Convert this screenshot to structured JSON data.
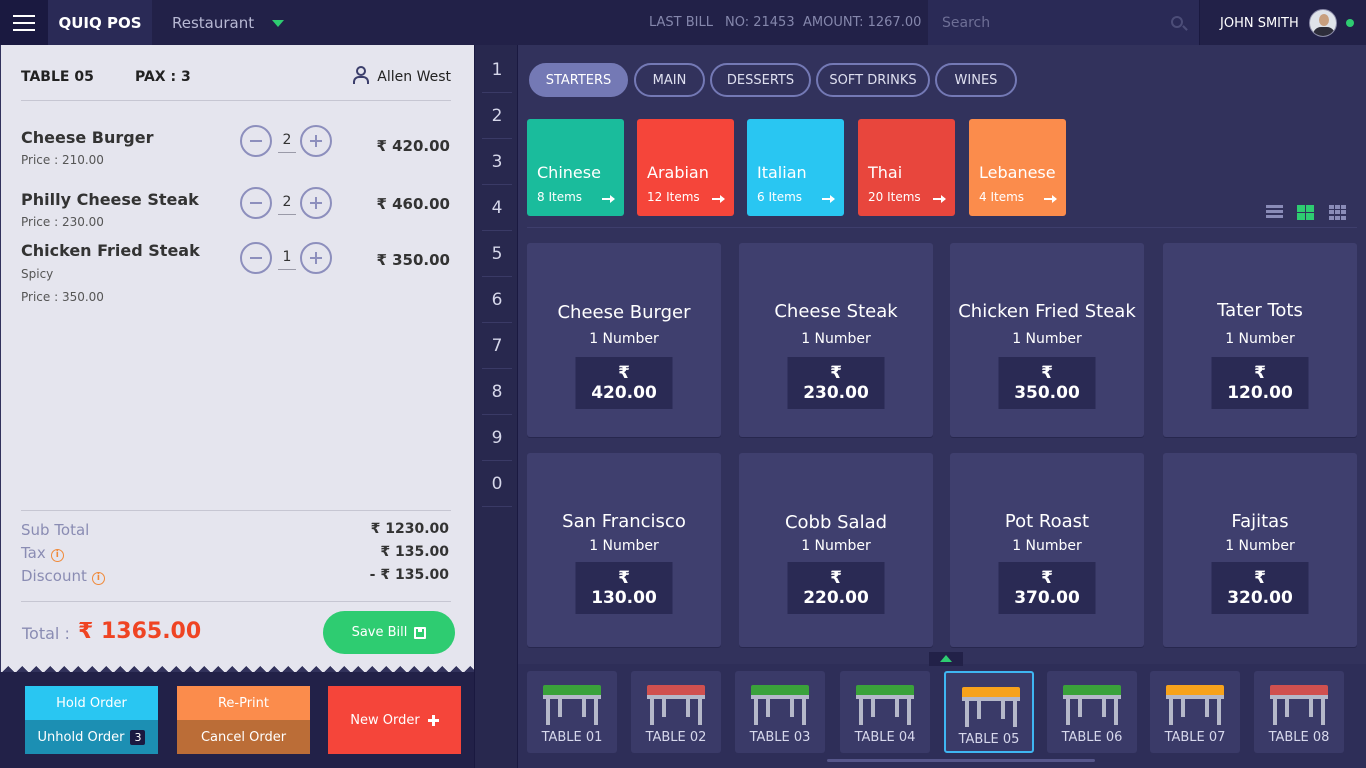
{
  "header": {
    "app_name": "QUIQ POS",
    "mode": "Restaurant",
    "last_bill": "LAST BILL",
    "bill_no": "NO: 21453",
    "amount": "AMOUNT: 1267.00",
    "search_placeholder": "Search",
    "user": "JOHN SMITH"
  },
  "order": {
    "table": "TABLE 05",
    "pax": "PAX : 3",
    "waiter": "Allen West",
    "items": [
      {
        "name": "Cheese Burger",
        "note": "",
        "price": "Price  : 210.00",
        "qty": "2",
        "amount": "₹ 420.00"
      },
      {
        "name": "Philly Cheese Steak",
        "note": "",
        "price": "Price  : 230.00",
        "qty": "2",
        "amount": "₹ 460.00"
      },
      {
        "name": "Chicken Fried Steak",
        "note": "Spicy",
        "price": "Price  : 350.00",
        "qty": "1",
        "amount": "₹ 350.00"
      }
    ],
    "subtotal_label": "Sub Total",
    "subtotal": "₹ 1230.00",
    "tax_label": "Tax",
    "tax": "₹ 135.00",
    "discount_label": "Discount",
    "discount": "- ₹ 135.00",
    "total_label": "Total  :",
    "total": "₹ 1365.00",
    "save_label": "Save Bill"
  },
  "actions": {
    "hold": "Hold Order",
    "unhold": "Unhold Order",
    "unhold_count": "3",
    "reprint": "Re-Print",
    "cancel": "Cancel Order",
    "new_order": "New Order"
  },
  "numpad": [
    "1",
    "2",
    "3",
    "4",
    "5",
    "6",
    "7",
    "8",
    "9",
    "0"
  ],
  "categories": [
    "STARTERS",
    "MAIN",
    "DESSERTS",
    "SOFT DRINKS",
    "WINES"
  ],
  "cuisines": [
    {
      "name": "Chinese",
      "items": "8 Items",
      "color": "#1abc9c"
    },
    {
      "name": "Arabian",
      "items": "12 Items",
      "color": "#f5453a"
    },
    {
      "name": "Italian",
      "items": "6 Items",
      "color": "#29c6f2"
    },
    {
      "name": "Thai",
      "items": "20 Items",
      "color": "#e8463d"
    },
    {
      "name": "Lebanese",
      "items": "4 Items",
      "color": "#fb8c4c"
    }
  ],
  "products": [
    {
      "name": "Cheese Burger",
      "unit": "1 Number",
      "price": "₹ 420.00"
    },
    {
      "name": "Cheese Steak",
      "unit": "1 Number",
      "price": "₹ 230.00"
    },
    {
      "name": "Chicken Fried Steak",
      "unit": "1 Number",
      "price": "₹ 350.00"
    },
    {
      "name": "Tater Tots",
      "unit": "1 Number",
      "price": "₹ 120.00"
    },
    {
      "name": "San Francisco",
      "unit": "1 Number",
      "price": "₹ 130.00"
    },
    {
      "name": "Cobb Salad",
      "unit": "1 Number",
      "price": "₹ 220.00"
    },
    {
      "name": "Pot Roast",
      "unit": "1 Number",
      "price": "₹ 370.00"
    },
    {
      "name": "Fajitas",
      "unit": "1 Number",
      "price": "₹ 320.00"
    }
  ],
  "tables": [
    {
      "label": "TABLE 01",
      "color": "#3aa23a"
    },
    {
      "label": "TABLE 02",
      "color": "#d0504f"
    },
    {
      "label": "TABLE 03",
      "color": "#3aa23a"
    },
    {
      "label": "TABLE 04",
      "color": "#3aa23a"
    },
    {
      "label": "TABLE 05",
      "color": "#f7a21b"
    },
    {
      "label": "TABLE 06",
      "color": "#3aa23a"
    },
    {
      "label": "TABLE 07",
      "color": "#f7a21b"
    },
    {
      "label": "TABLE 08",
      "color": "#d0504f"
    }
  ],
  "colors": {
    "accent_green": "#2ecc71",
    "total_red": "#ef4423",
    "active_pill": "#7479b5"
  }
}
